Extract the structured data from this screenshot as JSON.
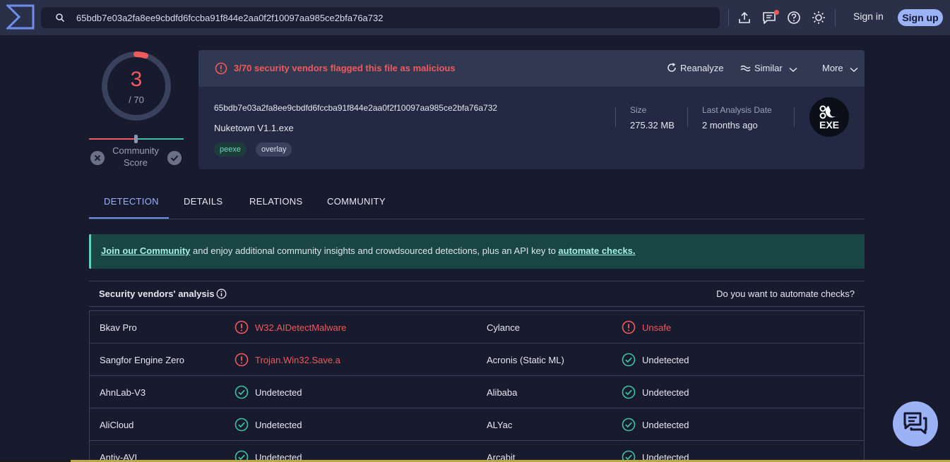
{
  "search": {
    "value": "65bdb7e03a2fa8ee9cbdfd6fccba91f844e2aa0f2f10097aa985ce2bfa76a732"
  },
  "auth": {
    "signin": "Sign in",
    "signup": "Sign up"
  },
  "score": {
    "detected": "3",
    "total": "/ 70",
    "community_label": "Community Score"
  },
  "summary": {
    "alert": "3/70 security vendors flagged this file as malicious",
    "actions": {
      "reanalyze": "Reanalyze",
      "similar": "Similar",
      "more": "More"
    },
    "hash": "65bdb7e03a2fa8ee9cbdfd6fccba91f844e2aa0f2f10097aa985ce2bfa76a732",
    "filename": "Nuketown V1.1.exe",
    "tags": [
      "peexe",
      "overlay"
    ],
    "size_label": "Size",
    "size_value": "275.32 MB",
    "last_label": "Last Analysis Date",
    "last_value": "2 months ago",
    "file_type": "EXE"
  },
  "tabs": [
    "DETECTION",
    "DETAILS",
    "RELATIONS",
    "COMMUNITY"
  ],
  "banner": {
    "link1": "Join our Community",
    "middle": " and enjoy additional community insights and crowdsourced detections, plus an API key to ",
    "link2": "automate checks."
  },
  "vendors": {
    "title": "Security vendors' analysis",
    "automate": "Do you want to automate checks?",
    "rows": [
      {
        "left_name": "Bkav Pro",
        "left_result": "W32.AIDetectMalware",
        "left_mal": true,
        "right_name": "Cylance",
        "right_result": "Unsafe",
        "right_mal": true
      },
      {
        "left_name": "Sangfor Engine Zero",
        "left_result": "Trojan.Win32.Save.a",
        "left_mal": true,
        "right_name": "Acronis (Static ML)",
        "right_result": "Undetected",
        "right_mal": false
      },
      {
        "left_name": "AhnLab-V3",
        "left_result": "Undetected",
        "left_mal": false,
        "right_name": "Alibaba",
        "right_result": "Undetected",
        "right_mal": false
      },
      {
        "left_name": "AliCloud",
        "left_result": "Undetected",
        "left_mal": false,
        "right_name": "ALYac",
        "right_result": "Undetected",
        "right_mal": false
      },
      {
        "left_name": "Antiy-AVL",
        "left_result": "Undetected",
        "left_mal": false,
        "right_name": "Arcabit",
        "right_result": "Undetected",
        "right_mal": false
      }
    ]
  },
  "colors": {
    "malicious": "#f05a5a",
    "clean": "#3cc4a0",
    "accent": "#9bb2f5"
  }
}
